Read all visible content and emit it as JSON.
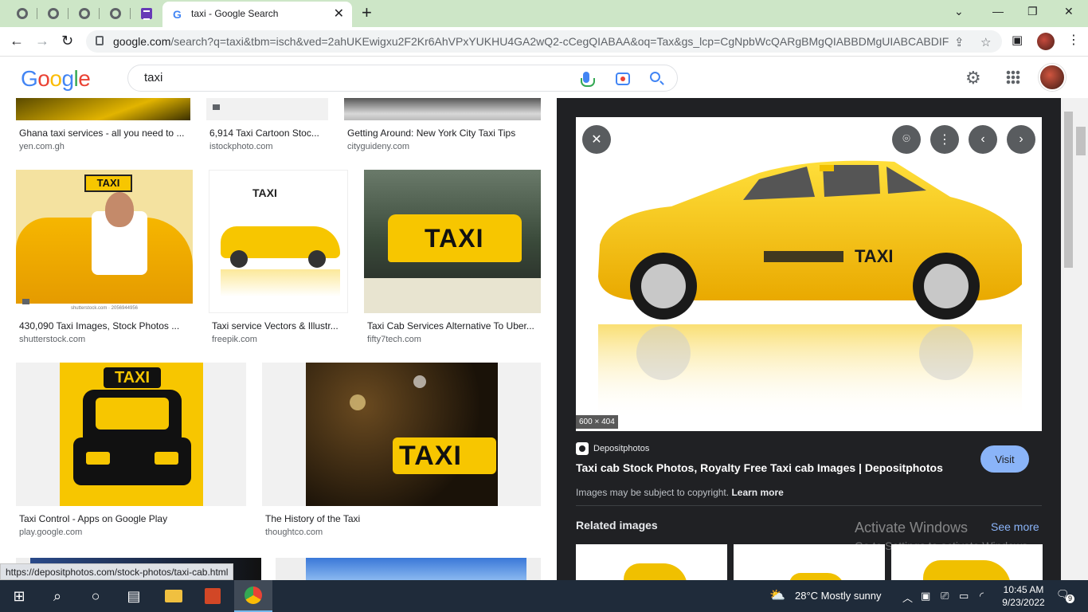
{
  "browser": {
    "tab_title": "taxi - Google Search",
    "url_host": "google.com",
    "url_path": "/search?q=taxi&tbm=isch&ved=2ahUKEwigxu2F2Kr6AhVPxYUKHU4GA2wQ2-cCegQIABAA&oq=Tax&gs_lcp=CgNpbWcQARgBMgQIABBDMgUIABCABDIFC...",
    "status_url": "https://depositphotos.com/stock-photos/taxi-cab.html"
  },
  "google": {
    "logo_letters": [
      "G",
      "o",
      "o",
      "g",
      "l",
      "e"
    ],
    "query": "taxi"
  },
  "results": [
    {
      "caption": "Ghana taxi services - all you need to ...",
      "source": "yen.com.gh"
    },
    {
      "caption": "6,914 Taxi Cartoon Stoc...",
      "source": "istockphoto.com"
    },
    {
      "caption": "Getting Around: New York City Taxi Tips",
      "source": "cityguideny.com"
    },
    {
      "caption": "430,090 Taxi Images, Stock Photos ...",
      "source": "shutterstock.com",
      "watermark": "shutterstock.com · 2056944956"
    },
    {
      "caption": "Taxi service Vectors & Illustr...",
      "source": "freepik.com"
    },
    {
      "caption": "Taxi Cab Services Alternative To Uber...",
      "source": "fifty7tech.com"
    },
    {
      "caption": "Taxi Control - Apps on Google Play",
      "source": "play.google.com"
    },
    {
      "caption": "The History of the Taxi",
      "source": "thoughtco.com"
    }
  ],
  "sign_text": "TAXI",
  "panel": {
    "dimensions": "600 × 404",
    "site_name": "Depositphotos",
    "title": "Taxi cab Stock Photos, Royalty Free Taxi cab Images | Depositphotos",
    "visit_label": "Visit",
    "copyright_text": "Images may be subject to copyright.",
    "learn_more": "Learn more",
    "related_label": "Related images",
    "see_more": "See more",
    "activate_title": "Activate Windows",
    "activate_sub": "Go to Settings to activate Windows."
  },
  "taskbar": {
    "weather": "28°C  Mostly sunny",
    "time": "10:45 AM",
    "date": "9/23/2022",
    "notif_count": "9"
  },
  "colors": {
    "taxi_yellow": "#f7c600",
    "panel_bg": "#202124",
    "accent_blue": "#8ab4f8"
  }
}
